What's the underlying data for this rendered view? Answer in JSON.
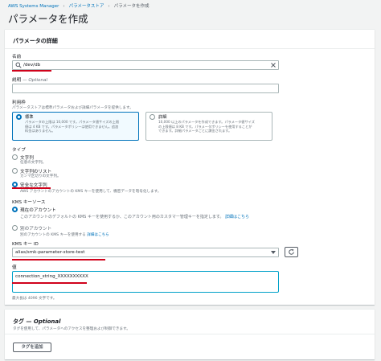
{
  "breadcrumb": {
    "root": "AWS Systems Manager",
    "middle": "パラメータストア",
    "current": "パラメータを作成"
  },
  "page_title": "パラメータを作成",
  "details": {
    "heading": "パラメータの詳細",
    "name_label": "名前",
    "name_value": "/dev/db",
    "description_label": "説明",
    "description_optional": "— Optional",
    "tier_label": "利用枠",
    "tier_desc": "パラメータストアは標準パラメータおよび詳細パラメータを提供します。",
    "tier_standard_title": "標準",
    "tier_standard_desc": "パラメータの上限は 10,000 です。パラメータ値サイズの上限値は 4 KB です。パラメータポリシーは使用できません。追加料金はありません。",
    "tier_advanced_title": "詳細",
    "tier_advanced_desc": "10,000 以上のパラメータを作成できます。パラメータ値サイズの上限値は 8 KB です。パラメータポリシーを使用することができます。詳細パラメータごとに課金されます。",
    "type_label": "タイプ",
    "type_string": "文字列",
    "type_string_desc": "任意の文字列。",
    "type_stringlist": "文字列のリスト",
    "type_stringlist_desc": "カンマ区切りの文字列。",
    "type_secure": "安全な文字列",
    "type_secure_desc": "AWS アカウントのアカウントの KMS キーを使用して、機密データを暗号化します。",
    "kms_source_label": "KMS キーソース",
    "kms_current_account": "現在のアカウント",
    "kms_current_desc": "このアカウントのデフォルトの KMS キーを使用するか、このアカウント用のカスタマー管理キーを指定します。",
    "kms_learn_more": "詳細はこちら",
    "kms_other_account": "別のアカウント",
    "kms_other_desc": "別のアカウントの KMS キーを使用する",
    "kms_key_id_label": "KMS キー ID",
    "kms_key_id_value": "alias/smk-parameter-store-test",
    "value_label": "値",
    "value_text": "connection_string_XXXXXXXXXX",
    "value_hint": "最大長は 4096 文字です。"
  },
  "tags": {
    "heading": "タグ",
    "heading_optional": "— Optional",
    "desc": "タグを使用して、パラメータへのアクセスを整理および制御できます。",
    "add_button": "タグを追加"
  },
  "icons": {
    "search": "search-icon",
    "clear": "close-icon",
    "dropdown": "caret-down-icon",
    "refresh": "refresh-icon"
  },
  "colors": {
    "accent": "#0073bb",
    "annotation": "#d0021b",
    "focus": "#00a1c9"
  }
}
